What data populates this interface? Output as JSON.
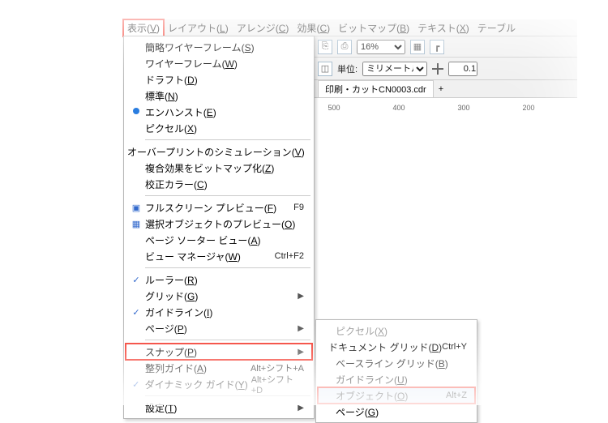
{
  "menubar": {
    "view": {
      "label": "表示",
      "accel": "V"
    },
    "layout": {
      "label": "レイアウト",
      "accel": "L"
    },
    "arrange": {
      "label": "アレンジ",
      "accel": "C"
    },
    "effects": {
      "label": "効果",
      "accel": "C"
    },
    "bitmap": {
      "label": "ビットマップ",
      "accel": "B"
    },
    "text": {
      "label": "テキスト",
      "accel": "X"
    },
    "table": {
      "label": "テーブル"
    }
  },
  "toolbar": {
    "zoom": "16%",
    "unit_label": "単位:",
    "unit_value": "ミリメートル",
    "nudge_value": "0.1"
  },
  "tab": {
    "filename": "印刷・カットCN0003.cdr"
  },
  "ruler": [
    "500",
    "400",
    "300",
    "200"
  ],
  "view_menu": {
    "simple_wf": {
      "label": "簡略ワイヤーフレーム",
      "accel": "S"
    },
    "wireframe": {
      "label": "ワイヤーフレーム",
      "accel": "W"
    },
    "draft": {
      "label": "ドラフト",
      "accel": "D"
    },
    "normal": {
      "label": "標準",
      "accel": "N"
    },
    "enhanced": {
      "label": "エンハンスト",
      "accel": "E"
    },
    "pixels": {
      "label": "ピクセル",
      "accel": "X"
    },
    "overprint": {
      "label": "オーバープリントのシミュレーション",
      "accel": "V"
    },
    "rasterize": {
      "label": "複合効果をビットマップ化",
      "accel": "Z"
    },
    "proof": {
      "label": "校正カラー",
      "accel": "C"
    },
    "fullscreen": {
      "label": "フルスクリーン プレビュー",
      "accel": "F",
      "shortcut": "F9"
    },
    "selpreview": {
      "label": "選択オブジェクトのプレビュー",
      "accel": "O"
    },
    "psorter": {
      "label": "ページ ソーター ビュー",
      "accel": "A"
    },
    "viewmgr": {
      "label": "ビュー マネージャ",
      "accel": "W",
      "shortcut": "Ctrl+F2"
    },
    "rulers": {
      "label": "ルーラー",
      "accel": "R"
    },
    "grid": {
      "label": "グリッド",
      "accel": "G"
    },
    "guidelines": {
      "label": "ガイドライン",
      "accel": "I"
    },
    "page": {
      "label": "ページ",
      "accel": "P"
    },
    "snap": {
      "label": "スナップ",
      "accel": "P"
    },
    "alignguides": {
      "label": "整列ガイド",
      "accel": "A",
      "shortcut": "Alt+シフト+A"
    },
    "dynguides": {
      "label": "ダイナミック ガイド",
      "accel": "Y",
      "shortcut": "Alt+シフト+D"
    },
    "settings": {
      "label": "設定",
      "accel": "T"
    }
  },
  "snap_menu": {
    "pixels": {
      "label": "ピクセル",
      "accel": "X"
    },
    "doc_grid": {
      "label": "ドキュメント グリッド",
      "accel": "D",
      "shortcut": "Ctrl+Y"
    },
    "base_grid": {
      "label": "ベースライン グリッド",
      "accel": "B"
    },
    "guideline": {
      "label": "ガイドライン",
      "accel": "U"
    },
    "object": {
      "label": "オブジェクト",
      "accel": "O",
      "shortcut": "Alt+Z"
    },
    "page": {
      "label": "ページ",
      "accel": "G"
    }
  }
}
